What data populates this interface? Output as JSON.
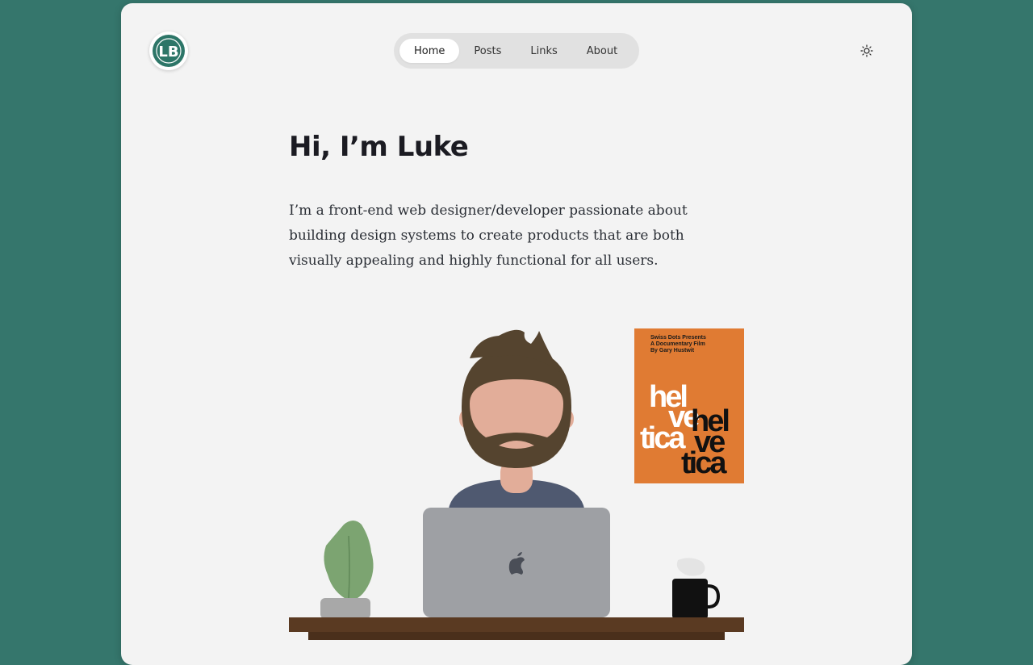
{
  "header": {
    "logo_text": "LB",
    "nav": [
      "Home",
      "Posts",
      "Links",
      "About"
    ],
    "active_nav": "Home",
    "theme_icon": "sun-icon"
  },
  "hero": {
    "title": "Hi, I’m Luke",
    "intro": "I’m a front-end web designer/developer passionate about building design systems to create products that are both visually appealing and highly functional for all users."
  },
  "poster": {
    "credit_lines": [
      "Swiss Dots Presents",
      "A Documentary Film",
      "By Gary Hustwit"
    ],
    "word_lines": [
      "hel",
      "ve",
      "tica"
    ]
  },
  "colors": {
    "background": "#35766c",
    "card": "#f3f3f3",
    "accent": "#2d7668",
    "poster": "#e07b33"
  }
}
